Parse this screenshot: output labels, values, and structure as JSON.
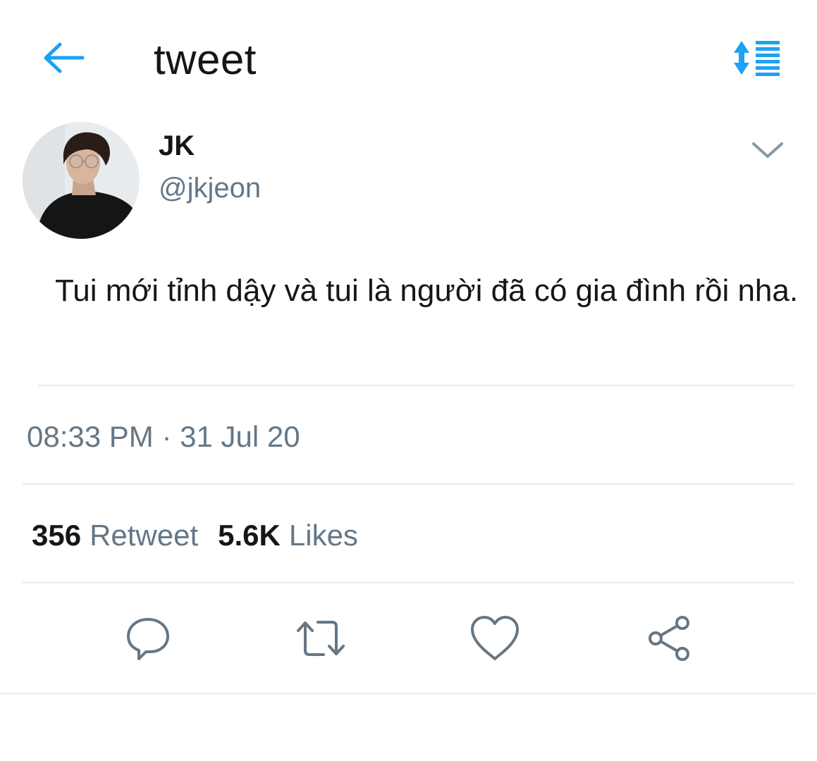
{
  "header": {
    "title": "tweet",
    "back_icon": "arrow-left-icon",
    "sort_icon": "sort-lines-icon",
    "accent_color": "#1da1f2"
  },
  "author": {
    "display_name": "JK",
    "handle": "@jkjeon",
    "avatar_icon": "profile-photo",
    "menu_icon": "chevron-down-icon"
  },
  "tweet": {
    "text": "Tui mới tỉnh dậy và tui là người đã có gia đình rồi nha.",
    "timestamp": "08:33 PM · 31 Jul 20"
  },
  "stats": {
    "retweets_count": "356",
    "retweets_label": "Retweet",
    "likes_count": "5.6K",
    "likes_label": "Likes"
  },
  "actions": [
    {
      "name": "reply",
      "icon": "reply-icon"
    },
    {
      "name": "retweet",
      "icon": "retweet-icon"
    },
    {
      "name": "like",
      "icon": "heart-icon"
    },
    {
      "name": "share",
      "icon": "share-icon"
    }
  ],
  "colors": {
    "primary_text": "#14171a",
    "secondary_text": "#657786",
    "divider": "#e6ecf0",
    "icon_gray": "#657786"
  }
}
